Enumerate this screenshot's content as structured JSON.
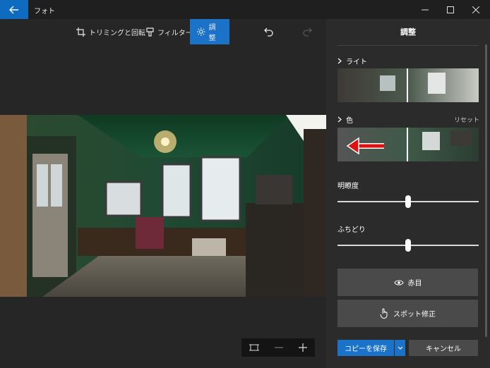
{
  "window": {
    "app_title": "フォト"
  },
  "toolbar": {
    "crop_label": "トリミングと回転",
    "filter_label": "フィルター",
    "adjust_label": "調整"
  },
  "panel": {
    "title": "調整",
    "light": {
      "label": "ライト"
    },
    "color": {
      "label": "色",
      "reset_label": "リセット"
    },
    "clarity": {
      "label": "明瞭度",
      "value": 0.5
    },
    "vignette": {
      "label": "ふちどり",
      "value": 0.5
    },
    "redeye_label": "赤目",
    "spotfix_label": "スポット修正",
    "save_label": "コピーを保存",
    "cancel_label": "キャンセル"
  },
  "colors": {
    "accent": "#1a73c9",
    "background": "#1f1f1f",
    "panel": "#2b2b2b",
    "annotation_arrow": "#e01010"
  },
  "zoom": {
    "icons": [
      "fit-to-window-icon",
      "zoom-out-icon",
      "zoom-in-icon"
    ]
  }
}
